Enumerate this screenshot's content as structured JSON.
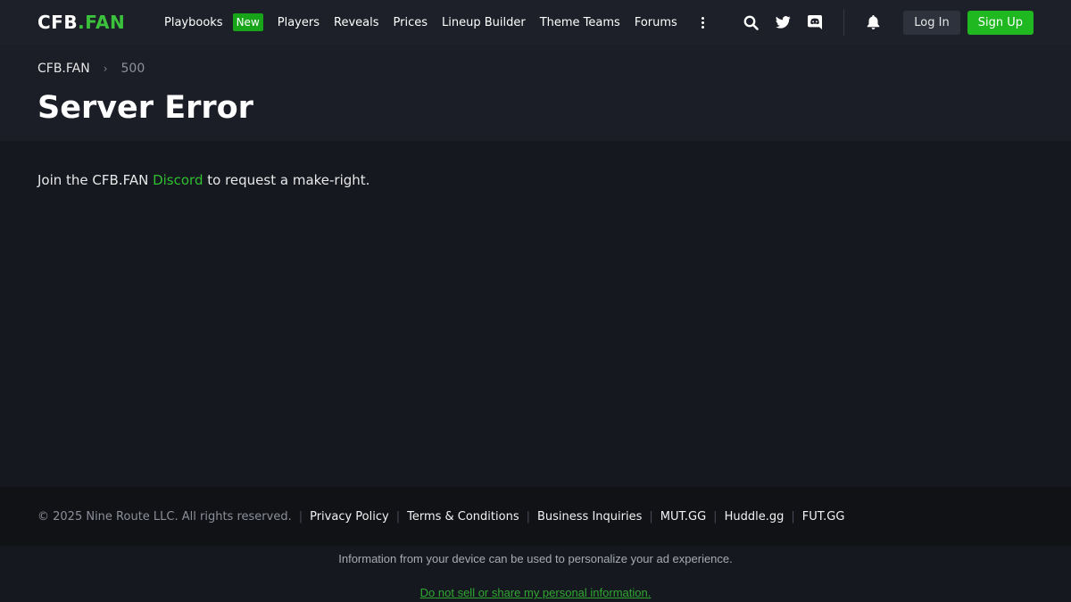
{
  "nav": {
    "logo_part1": "CFB",
    "logo_part2": ".FAN",
    "items": [
      {
        "label": "Playbooks",
        "badge": "New"
      },
      {
        "label": "Players"
      },
      {
        "label": "Reveals"
      },
      {
        "label": "Prices"
      },
      {
        "label": "Lineup Builder"
      },
      {
        "label": "Theme Teams"
      },
      {
        "label": "Forums"
      }
    ],
    "login_label": "Log In",
    "signup_label": "Sign Up",
    "icons": [
      "search-icon",
      "twitter-icon",
      "discord-icon",
      "bell-icon",
      "more-vertical-icon"
    ]
  },
  "breadcrumb": {
    "home": "CFB.FAN",
    "current": "500"
  },
  "page": {
    "title": "Server Error",
    "message_before": "Join the CFB.FAN ",
    "message_link": "Discord",
    "message_after": " to request a make-right."
  },
  "footer": {
    "copyright": "© 2025 Nine Route LLC. All rights reserved.",
    "links": [
      "Privacy Policy",
      "Terms & Conditions",
      "Business Inquiries",
      "MUT.GG",
      "Huddle.gg",
      "FUT.GG"
    ]
  },
  "ad_notice": {
    "info": "Information from your device can be used to personalize your ad experience.",
    "link": "Do not sell or share my personal information."
  },
  "colors": {
    "accent_green": "#20b820",
    "background": "#161820",
    "nav_background": "#1d2029"
  }
}
